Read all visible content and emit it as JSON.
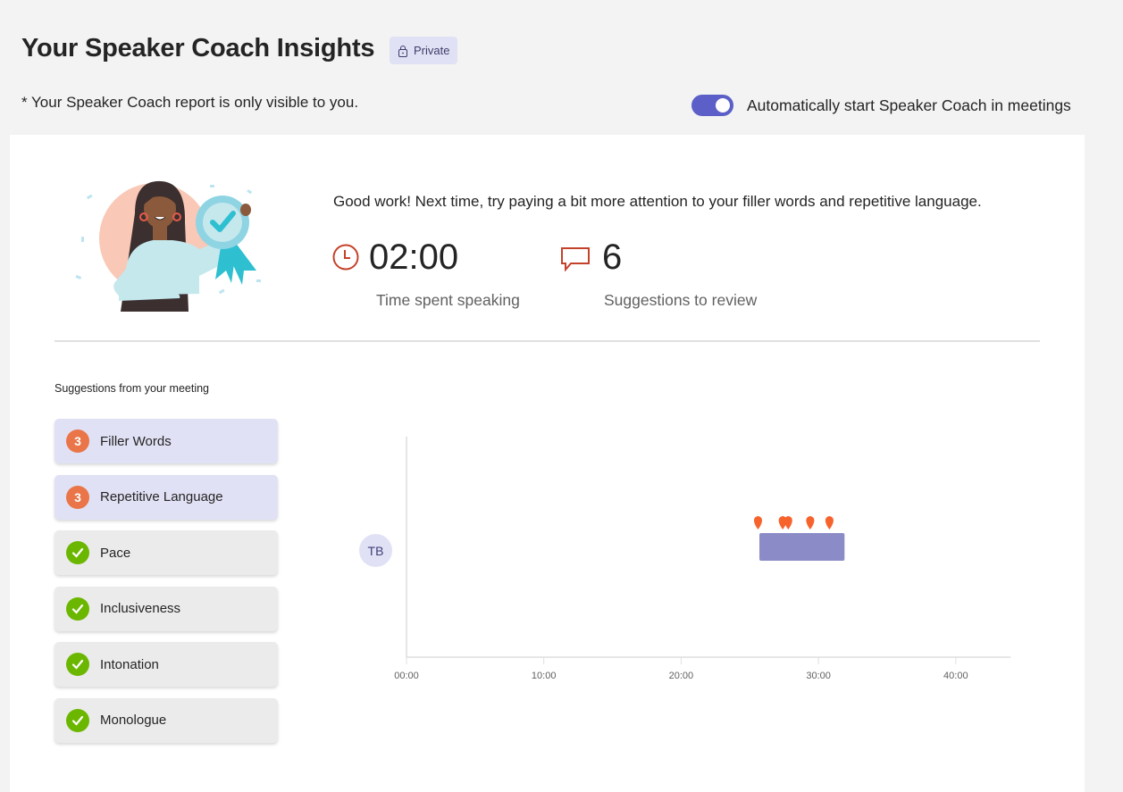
{
  "header": {
    "title": "Your Speaker Coach Insights",
    "private_badge": "Private",
    "visibility_note": "* Your Speaker Coach report is only visible to you.",
    "auto_start_toggle": {
      "label": "Automatically start Speaker Coach in meetings",
      "on": true
    }
  },
  "colors": {
    "accent": "#5b5fc7",
    "warning_badge": "#e97548",
    "ok_badge": "#6bb700",
    "stat_icon": "#c4422a",
    "speaking_bar": "#8b8cc7",
    "marker": "#f7632c"
  },
  "summary": {
    "message": "Good work! Next time, try paying a bit more attention to your filler words and repetitive language.",
    "stats": [
      {
        "icon": "clock-icon",
        "value": "02:00",
        "label": "Time spent speaking"
      },
      {
        "icon": "comment-icon",
        "value": "6",
        "label": "Suggestions to review"
      }
    ]
  },
  "suggestions": {
    "title": "Suggestions from your meeting",
    "items": [
      {
        "label": "Filler Words",
        "status": "warn",
        "count": "3"
      },
      {
        "label": "Repetitive Language",
        "status": "warn",
        "count": "3"
      },
      {
        "label": "Pace",
        "status": "ok"
      },
      {
        "label": "Inclusiveness",
        "status": "ok"
      },
      {
        "label": "Intonation",
        "status": "ok"
      },
      {
        "label": "Monologue",
        "status": "ok"
      }
    ]
  },
  "chart_data": {
    "type": "timeline",
    "title": "",
    "xlabel": "",
    "ylabel": "",
    "x_unit": "minutes",
    "xlim": [
      0,
      44
    ],
    "x_ticks": [
      0,
      10,
      20,
      30,
      40
    ],
    "x_tick_labels": [
      "00:00",
      "10:00",
      "20:00",
      "30:00",
      "40:00"
    ],
    "speakers": [
      {
        "initials": "TB",
        "segments": [
          {
            "start": 25.7,
            "end": 31.9
          }
        ],
        "markers": [
          25.6,
          27.4,
          27.8,
          29.4,
          30.8
        ]
      }
    ]
  }
}
